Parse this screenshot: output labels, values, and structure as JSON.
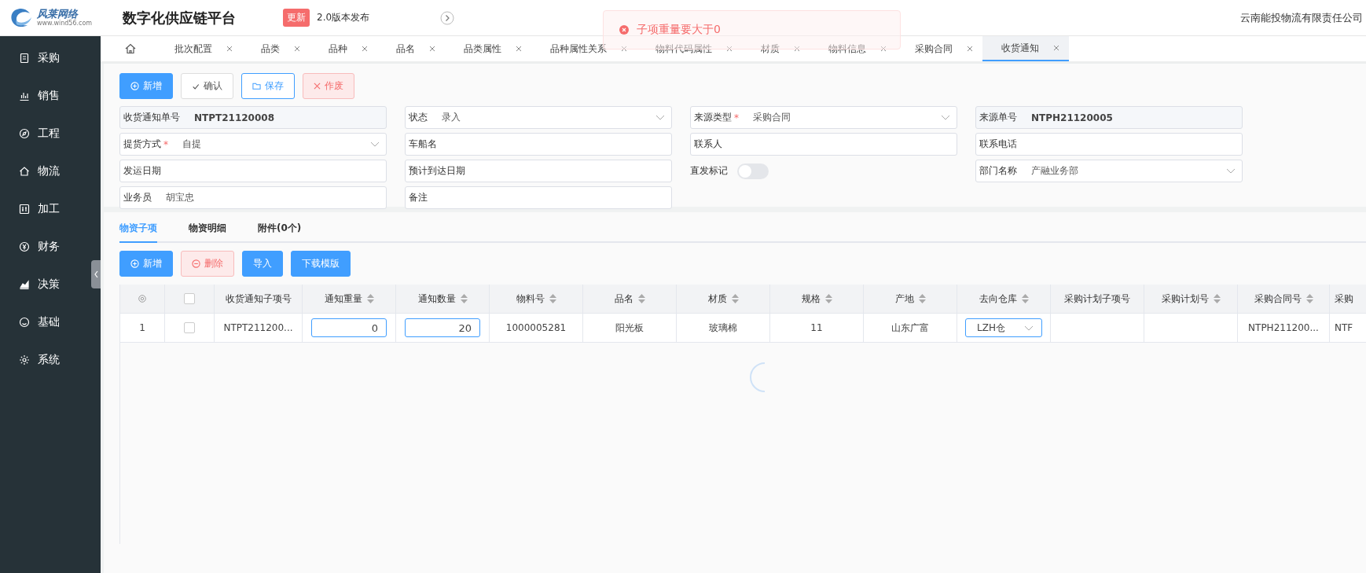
{
  "header": {
    "logo_text": "风莱网络",
    "logo_url": "www.wind56.com",
    "app_title": "数字化供应链平台",
    "badge": "更新",
    "announcement": "2.0版本发布",
    "company": "云南能投物流有限责任公司"
  },
  "toast": {
    "kind": "error",
    "message": "子项重量要大于0"
  },
  "sidebar": {
    "items": [
      {
        "label": "采购"
      },
      {
        "label": "销售"
      },
      {
        "label": "工程"
      },
      {
        "label": "物流"
      },
      {
        "label": "加工"
      },
      {
        "label": "财务"
      },
      {
        "label": "决策"
      },
      {
        "label": "基础"
      },
      {
        "label": "系统"
      }
    ]
  },
  "tabs": [
    {
      "label": "批次配置",
      "selected": false
    },
    {
      "label": "品类",
      "selected": false
    },
    {
      "label": "品种",
      "selected": false
    },
    {
      "label": "品名",
      "selected": false
    },
    {
      "label": "品类属性",
      "selected": false
    },
    {
      "label": "品种属性关系",
      "selected": false
    },
    {
      "label": "物料代码属性",
      "selected": false
    },
    {
      "label": "材质",
      "selected": false
    },
    {
      "label": "物料信息",
      "selected": false
    },
    {
      "label": "采购合同",
      "selected": false
    },
    {
      "label": "收货通知",
      "selected": true
    }
  ],
  "toolbar": [
    {
      "label": "新增",
      "kind": "primary"
    },
    {
      "label": "确认",
      "kind": "plain"
    },
    {
      "label": "保存",
      "kind": "outline"
    },
    {
      "label": "作废",
      "kind": "danger"
    }
  ],
  "form": {
    "fields": [
      {
        "label": "收货通知单号",
        "value": "NTPT21120008",
        "kind": "readonly"
      },
      {
        "label": "状态",
        "value": "录入",
        "kind": "select"
      },
      {
        "label": "来源类型",
        "value": "采购合同",
        "required_mark": "*",
        "kind": "select"
      },
      {
        "label": "来源单号",
        "value": "NTPH21120005",
        "kind": "readonly"
      },
      {
        "label": "提货方式",
        "value": "自提",
        "required_mark": "*",
        "kind": "select"
      },
      {
        "label": "车船名",
        "kind": "text"
      },
      {
        "label": "联系人",
        "kind": "text"
      },
      {
        "label": "联系电话",
        "kind": "text"
      },
      {
        "label": "发运日期",
        "kind": "text"
      },
      {
        "label": "预计到达日期",
        "kind": "text"
      },
      {
        "label": "直发标记",
        "on": false,
        "kind": "switch"
      },
      {
        "label": "部门名称",
        "value": "产融业务部",
        "kind": "select"
      },
      {
        "label": "业务员",
        "value": "胡宝忠",
        "kind": "text"
      },
      {
        "label": "备注",
        "kind": "text"
      }
    ]
  },
  "detail_tabs": [
    {
      "label": "物资子项",
      "selected": true
    },
    {
      "label": "物资明细",
      "selected": false
    },
    {
      "label": "附件(0个)",
      "selected": false
    }
  ],
  "detail_toolbar": [
    {
      "label": "新增",
      "kind": "primary"
    },
    {
      "label": "删除",
      "kind": "danger"
    },
    {
      "label": "导入",
      "kind": "solid"
    },
    {
      "label": "下载模版",
      "kind": "solid"
    }
  ],
  "table": {
    "header_checked": false,
    "columns": [
      {
        "label": "收货通知子项号",
        "sortable": false
      },
      {
        "label": "通知重量",
        "sortable": true
      },
      {
        "label": "通知数量",
        "sortable": true
      },
      {
        "label": "物料号",
        "sortable": true
      },
      {
        "label": "品名",
        "sortable": true
      },
      {
        "label": "材质",
        "sortable": true
      },
      {
        "label": "规格",
        "sortable": true
      },
      {
        "label": "产地",
        "sortable": true
      },
      {
        "label": "去向仓库",
        "sortable": true
      },
      {
        "label": "采购计划子项号",
        "sortable": false
      },
      {
        "label": "采购计划号",
        "sortable": true
      },
      {
        "label": "采购合同号",
        "sortable": true
      },
      {
        "label": "采购",
        "sortable": false
      }
    ],
    "rows": [
      {
        "index": "1",
        "checked": false,
        "cells": [
          {
            "kind": "text",
            "value": "NTPT211200..."
          },
          {
            "kind": "input",
            "value": "0"
          },
          {
            "kind": "input",
            "value": "20"
          },
          {
            "kind": "text",
            "value": "1000005281"
          },
          {
            "kind": "text",
            "value": "阳光板"
          },
          {
            "kind": "text",
            "value": "玻璃棉"
          },
          {
            "kind": "text",
            "value": "11"
          },
          {
            "kind": "text",
            "value": "山东广富"
          },
          {
            "kind": "select",
            "value": "LZH仓"
          },
          {
            "kind": "empty"
          },
          {
            "kind": "empty"
          },
          {
            "kind": "text",
            "value": "NTPH211200..."
          },
          {
            "kind": "text",
            "value": "NTF"
          }
        ]
      }
    ]
  }
}
